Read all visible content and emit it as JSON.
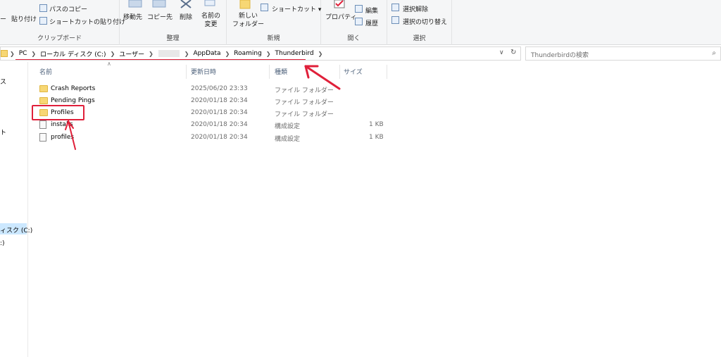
{
  "ribbon": {
    "clipboard": {
      "label": "クリップボード",
      "partial_label": "ー",
      "paste_label": "貼り付け",
      "copy_path_label": "パスのコピー",
      "paste_shortcut_label": "ショートカットの貼り付け"
    },
    "organize": {
      "label": "整理",
      "move_label": "移動先",
      "copy_label": "コピー先",
      "delete_label": "削除",
      "rename_label": "名前の\n変更"
    },
    "new": {
      "label": "新規",
      "new_folder_label": "新しい\nフォルダー",
      "shortcut_label": "ショートカット ▾"
    },
    "open": {
      "label": "開く",
      "properties_label": "プロパティ",
      "edit_label": "編集",
      "history_label": "履歴"
    },
    "select": {
      "label": "選択",
      "deselect_label": "選択解除",
      "invert_label": "選択の切り替え"
    }
  },
  "address": {
    "crumbs": [
      "PC",
      "ローカル ディスク (C:)",
      "ユーザー",
      "AppData",
      "Roaming",
      "Thunderbird"
    ],
    "search_placeholder": "Thunderbirdの検索"
  },
  "nav": {
    "items": [
      {
        "label": "ス"
      },
      {
        "label": "ト"
      },
      {
        "label": "ィスク (C:)"
      },
      {
        "label": ":)"
      }
    ]
  },
  "columns": {
    "name": "名前",
    "date": "更新日時",
    "type": "種類",
    "size": "サイズ"
  },
  "files": [
    {
      "name": "Crash Reports",
      "date": "2025/06/20 23:33",
      "type": "ファイル フォルダー",
      "size": "",
      "kind": "folder"
    },
    {
      "name": "Pending Pings",
      "date": "2020/01/18 20:34",
      "type": "ファイル フォルダー",
      "size": "",
      "kind": "folder"
    },
    {
      "name": "Profiles",
      "date": "2020/01/18 20:34",
      "type": "ファイル フォルダー",
      "size": "",
      "kind": "folder"
    },
    {
      "name": "installs",
      "date": "2020/01/18 20:34",
      "type": "構成設定",
      "size": "1 KB",
      "kind": "file"
    },
    {
      "name": "profiles",
      "date": "2020/01/18 20:34",
      "type": "構成設定",
      "size": "1 KB",
      "kind": "file"
    }
  ]
}
